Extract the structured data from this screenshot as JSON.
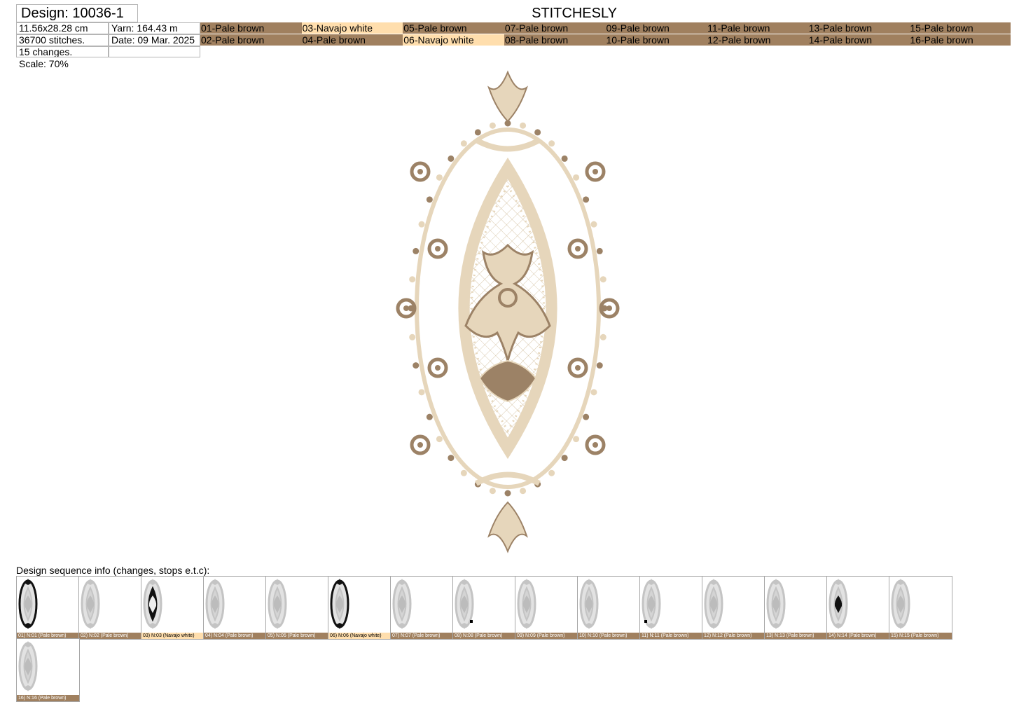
{
  "header": {
    "design_title": "Design: 10036-1",
    "size": "11.56x28.28 cm",
    "yarn": "Yarn: 164.43 m",
    "stitches": "36700 stitches.",
    "date": "Date: 09 Mar. 2025",
    "changes": "15 changes.",
    "scale": "Scale: 70%",
    "brand": "STITCHESLY"
  },
  "colors": {
    "pale_brown": "#A0805F",
    "navajo_white": "#FFDEAD",
    "fill_light": "#E6D6BB",
    "fill_dark": "#9C8266"
  },
  "threads_row1": [
    {
      "label": "01-Pale brown",
      "color": "pale"
    },
    {
      "label": "03-Navajo white",
      "color": "navajo"
    },
    {
      "label": "05-Pale brown",
      "color": "pale"
    },
    {
      "label": "07-Pale brown",
      "color": "pale"
    },
    {
      "label": "09-Pale brown",
      "color": "pale"
    },
    {
      "label": "11-Pale brown",
      "color": "pale"
    },
    {
      "label": "13-Pale brown",
      "color": "pale"
    },
    {
      "label": "15-Pale brown",
      "color": "pale"
    }
  ],
  "threads_row2": [
    {
      "label": "02-Pale brown",
      "color": "pale"
    },
    {
      "label": "04-Pale brown",
      "color": "pale"
    },
    {
      "label": "06-Navajo white",
      "color": "navajo"
    },
    {
      "label": "08-Pale brown",
      "color": "pale"
    },
    {
      "label": "10-Pale brown",
      "color": "pale"
    },
    {
      "label": "12-Pale brown",
      "color": "pale"
    },
    {
      "label": "14-Pale brown",
      "color": "pale"
    },
    {
      "label": "16-Pale brown",
      "color": "pale"
    }
  ],
  "sequence": {
    "heading": "Design sequence info (changes, stops e.t.c):",
    "steps": [
      {
        "label": "01) N:01 (Pale brown)",
        "color": "pale",
        "highlight": "frame"
      },
      {
        "label": "02) N:02 (Pale brown)",
        "color": "pale",
        "highlight": "none"
      },
      {
        "label": "03) N:03 (Navajo white)",
        "color": "navajo",
        "highlight": "band"
      },
      {
        "label": "04) N:04 (Pale brown)",
        "color": "pale",
        "highlight": "none"
      },
      {
        "label": "05) N:05 (Pale brown)",
        "color": "pale",
        "highlight": "none"
      },
      {
        "label": "06) N:06 (Navajo white)",
        "color": "navajo",
        "highlight": "frame"
      },
      {
        "label": "07) N:07 (Pale brown)",
        "color": "pale",
        "highlight": "none"
      },
      {
        "label": "08) N:08 (Pale brown)",
        "color": "pale",
        "highlight": "dot-right"
      },
      {
        "label": "09) N:09 (Pale brown)",
        "color": "pale",
        "highlight": "none"
      },
      {
        "label": "10) N:10 (Pale brown)",
        "color": "pale",
        "highlight": "none"
      },
      {
        "label": "11) N:11 (Pale brown)",
        "color": "pale",
        "highlight": "dot-left"
      },
      {
        "label": "12) N:12 (Pale brown)",
        "color": "pale",
        "highlight": "none"
      },
      {
        "label": "13) N:13 (Pale brown)",
        "color": "pale",
        "highlight": "none"
      },
      {
        "label": "14) N:14 (Pale brown)",
        "color": "pale",
        "highlight": "center"
      },
      {
        "label": "15) N:15 (Pale brown)",
        "color": "pale",
        "highlight": "none"
      },
      {
        "label": "16) N:16 (Pale brown)",
        "color": "pale",
        "highlight": "none"
      }
    ]
  }
}
